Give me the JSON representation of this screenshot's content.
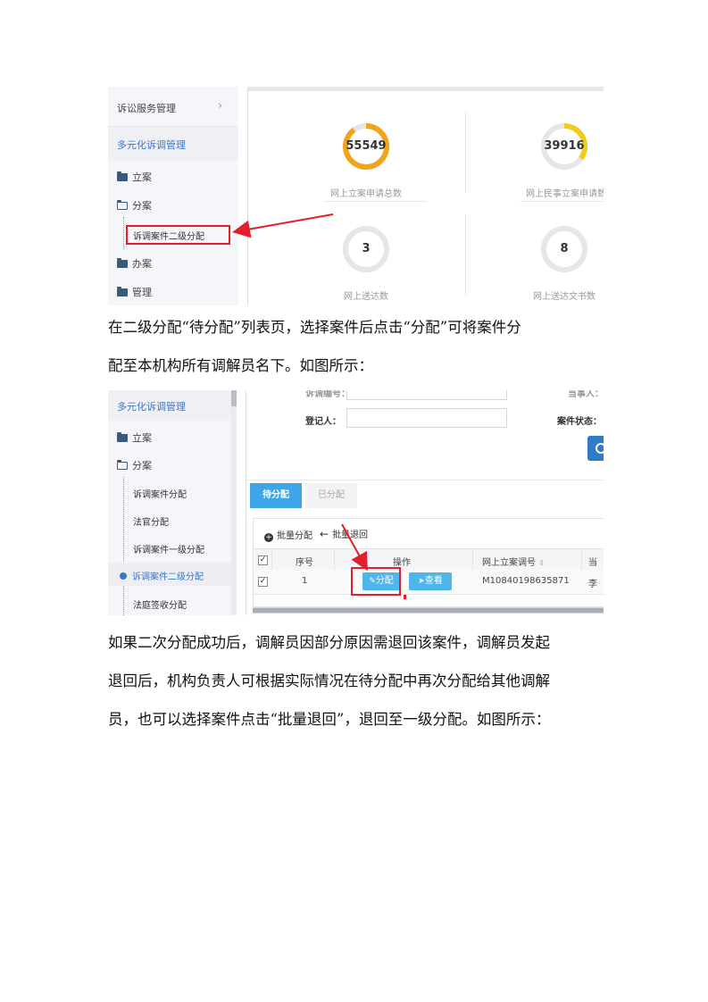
{
  "screenshot1": {
    "sidebar": {
      "items": [
        {
          "label": "诉讼服务管理"
        },
        {
          "label": "多元化诉调管理"
        },
        {
          "label": "立案"
        },
        {
          "label": "分案"
        },
        {
          "label": "诉调案件二级分配"
        },
        {
          "label": "办案"
        },
        {
          "label": "管理"
        }
      ],
      "chevron": "›"
    },
    "stats": [
      {
        "value": "55549",
        "label": "网上立案申请总数",
        "ring_color": "#f0a51c",
        "fill": 0.9
      },
      {
        "value": "39916",
        "label": "网上民事立案申请数",
        "ring_color": "#f2cc1a",
        "fill": 0.35
      },
      {
        "value": "3",
        "label": "网上送达数",
        "ring_color": "#e6e6e6",
        "fill": 0
      },
      {
        "value": "8",
        "label": "网上送达文书数",
        "ring_color": "#e6e6e6",
        "fill": 0
      }
    ]
  },
  "paragraph1": {
    "line1": "在二级分配“待分配”列表页，选择案件后点击“分配”可将案件分",
    "line2": "配至本机构所有调解员名下。如图所示："
  },
  "screenshot2": {
    "sidebar": {
      "items": [
        {
          "label": "多元化诉调管理"
        },
        {
          "label": "立案"
        },
        {
          "label": "分案"
        },
        {
          "label": "诉调案件分配"
        },
        {
          "label": "法官分配"
        },
        {
          "label": "诉调案件一级分配"
        },
        {
          "label": "诉调案件二级分配"
        },
        {
          "label": "法庭签收分配"
        }
      ]
    },
    "form": {
      "field_top_label": "诉调编号：",
      "registrar_label": "登记人：",
      "right_top_label": "当事人：",
      "status_label": "案件状态："
    },
    "tabs": [
      {
        "label": "待分配"
      },
      {
        "label": "已分配"
      }
    ],
    "toolbar": {
      "batch_assign": "批量分配",
      "batch_return": "批量退回"
    },
    "table": {
      "headers": [
        "序号",
        "操作",
        "网上立案调号",
        "当"
      ],
      "rows": [
        {
          "index": "1",
          "assign_btn": "分配",
          "view_btn": "查看",
          "case_no": "M10840198635871",
          "partial": "李"
        }
      ]
    }
  },
  "paragraph2": {
    "line1": "如果二次分配成功后，调解员因部分原因需退回该案件，调解员发起",
    "line2": "退回后，机构负责人可根据实际情况在待分配中再次分配给其他调解",
    "line3": "员，也可以选择案件点击“批量退回”，退回至一级分配。如图所示："
  }
}
